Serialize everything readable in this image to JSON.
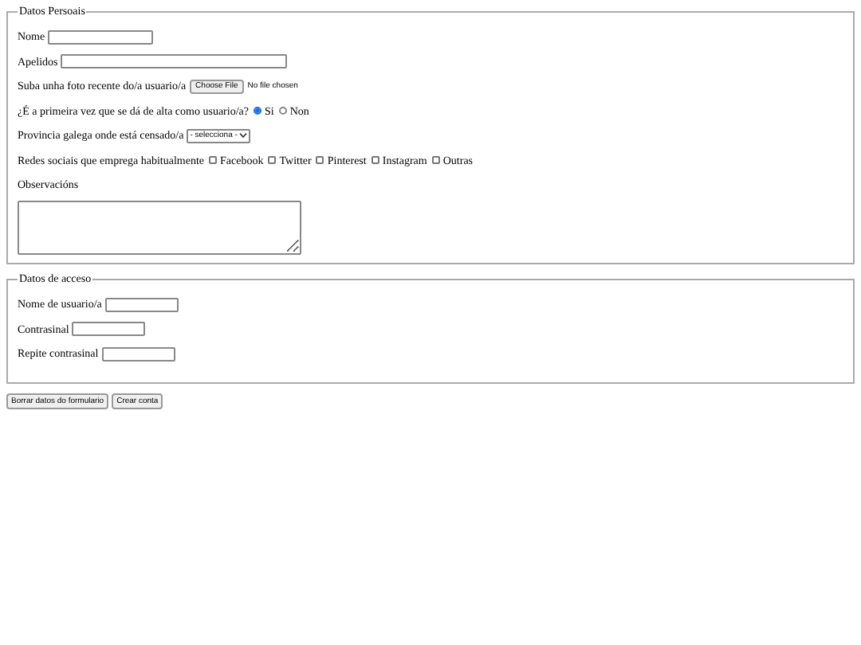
{
  "sections": [
    {
      "legend": "Datos Persoais",
      "fields": [
        {
          "kind": "text",
          "label": "Nome"
        },
        {
          "kind": "wide-text",
          "label": "Apelidos"
        },
        {
          "kind": "file",
          "label": "Suba unha foto recente do/a usuario/a",
          "button": "Choose File",
          "status": "No file chosen"
        },
        {
          "kind": "radio",
          "label": "¿É a primeira vez que se dá de alta como usuario/a?",
          "options": [
            {
              "label": "Si",
              "selected": true
            },
            {
              "label": "Non",
              "selected": false
            }
          ]
        },
        {
          "kind": "select",
          "label": "Provincia galega onde está censado/a",
          "value": "- selecciona -"
        },
        {
          "kind": "checkboxes",
          "label": "Redes sociais que emprega habitualmente",
          "options": [
            {
              "label": "Facebook",
              "checked": false
            },
            {
              "label": "Twitter",
              "checked": false
            },
            {
              "label": "Pinterest",
              "checked": false
            },
            {
              "label": "Instagram",
              "checked": false
            },
            {
              "label": "Outras",
              "checked": false
            }
          ]
        },
        {
          "kind": "textarea",
          "label": "Observacións"
        }
      ]
    },
    {
      "legend": "Datos de acceso",
      "fields": [
        {
          "kind": "short-text",
          "label": "Nome de usuario/a"
        },
        {
          "kind": "short-text",
          "label": "Contrasinal"
        },
        {
          "kind": "short-text",
          "label": "Repite contrasinal"
        }
      ]
    }
  ],
  "buttons": [
    "Borrar datos do formulario",
    "Crear conta"
  ]
}
